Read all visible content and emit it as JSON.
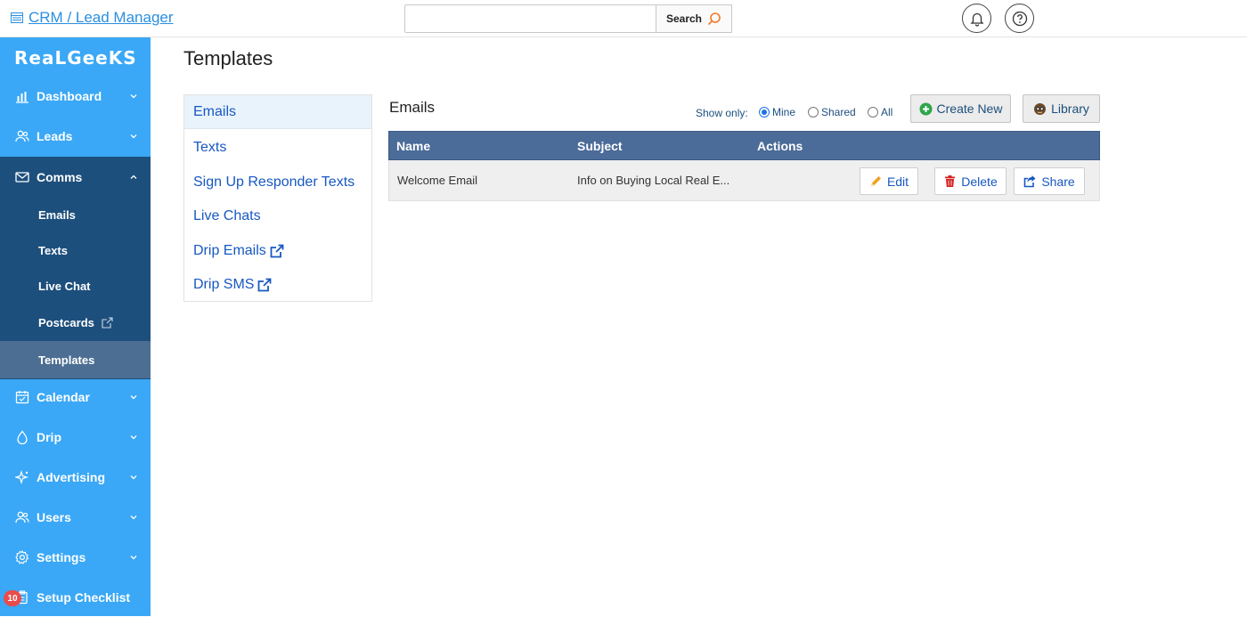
{
  "topbar": {
    "app_title": "CRM / Lead Manager",
    "search_placeholder": "",
    "search_label": "Search"
  },
  "sidebar": {
    "logo": "RealGeeks",
    "items": [
      {
        "label": "Dashboard",
        "icon": "bar-chart-icon"
      },
      {
        "label": "Leads",
        "icon": "users-icon"
      },
      {
        "label": "Comms",
        "icon": "envelope-icon"
      },
      {
        "label": "Calendar",
        "icon": "calendar-icon"
      },
      {
        "label": "Drip",
        "icon": "drop-icon"
      },
      {
        "label": "Advertising",
        "icon": "sparkle-icon"
      },
      {
        "label": "Users",
        "icon": "users-icon"
      },
      {
        "label": "Settings",
        "icon": "gear-icon"
      },
      {
        "label": "Setup Checklist",
        "icon": "clipboard-icon"
      }
    ],
    "comms_sub": [
      {
        "label": "Emails"
      },
      {
        "label": "Texts"
      },
      {
        "label": "Live Chat"
      },
      {
        "label": "Postcards"
      },
      {
        "label": "Templates",
        "active": true
      }
    ],
    "checklist_badge": "10"
  },
  "main": {
    "page_title": "Templates",
    "left_menu": [
      {
        "label": "Emails",
        "active": true
      },
      {
        "label": "Texts"
      },
      {
        "label": "Sign Up Responder Texts"
      },
      {
        "label": "Live Chats"
      },
      {
        "label": "Drip Emails",
        "external": true
      },
      {
        "label": "Drip SMS",
        "external": true
      }
    ],
    "section_title": "Emails",
    "show_only_label": "Show only:",
    "filters": [
      {
        "label": "Mine",
        "selected": true
      },
      {
        "label": "Shared",
        "selected": false
      },
      {
        "label": "All",
        "selected": false
      }
    ],
    "create_new_label": "Create New",
    "library_label": "Library",
    "table": {
      "columns": [
        "Name",
        "Subject",
        "Actions"
      ],
      "rows": [
        {
          "name": "Welcome Email",
          "subject": "Info on Buying Local Real E..."
        }
      ],
      "edit_label": "Edit",
      "delete_label": "Delete",
      "share_label": "Share"
    }
  },
  "colors": {
    "sidebar_bg": "#3aa8f6",
    "sidebar_active_bg": "#1d4f7d",
    "link": "#1758c2",
    "table_header": "#4b6b98"
  }
}
